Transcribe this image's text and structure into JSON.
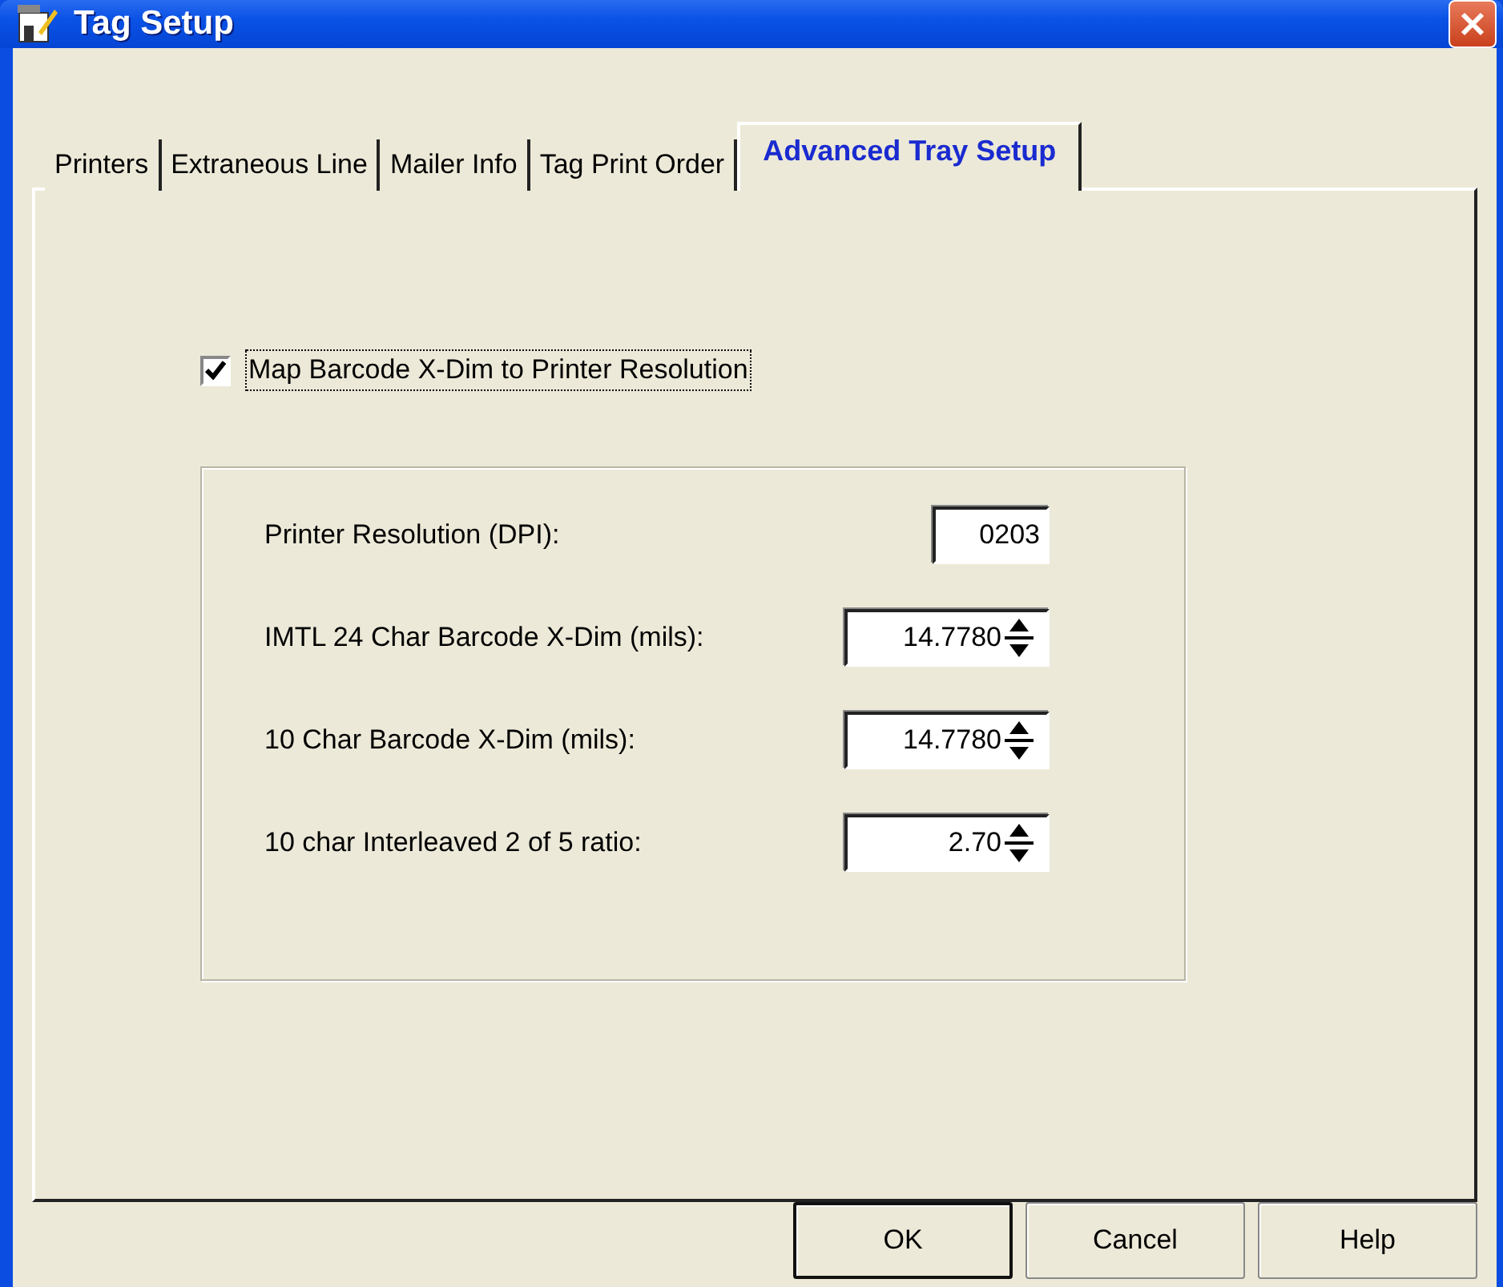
{
  "window": {
    "title": "Tag Setup"
  },
  "tabs": [
    {
      "label": "Printers",
      "selected": false
    },
    {
      "label": "Extraneous Line",
      "selected": false
    },
    {
      "label": "Mailer Info",
      "selected": false
    },
    {
      "label": "Tag Print Order",
      "selected": false
    },
    {
      "label": "Advanced Tray Setup",
      "selected": true
    }
  ],
  "map_checkbox": {
    "label": "Map Barcode X-Dim to Printer Resolution",
    "checked": true,
    "focused": true
  },
  "settings": [
    {
      "kind": "text",
      "label": "Printer Resolution (DPI):",
      "value": "0203"
    },
    {
      "kind": "spin",
      "label": "IMTL 24 Char Barcode X-Dim (mils):",
      "value": "14.7780"
    },
    {
      "kind": "spin",
      "label": "10 Char Barcode X-Dim (mils):",
      "value": "14.7780"
    },
    {
      "kind": "spin",
      "label": "10 char Interleaved 2 of 5 ratio:",
      "value": "2.70"
    }
  ],
  "buttons": [
    {
      "label": "OK",
      "default": true
    },
    {
      "label": "Cancel",
      "default": false
    },
    {
      "label": "Help",
      "default": false
    }
  ]
}
